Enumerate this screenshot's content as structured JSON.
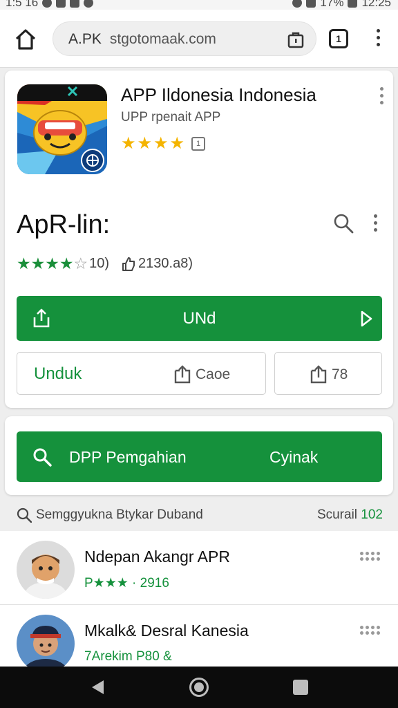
{
  "status_bar": {
    "left_text": "1:5 16",
    "right_text": "17%",
    "time": "12:25"
  },
  "browser": {
    "url_prefix": "A.PK",
    "url_host": "stgotomaak.com",
    "tabs_count": "1"
  },
  "app_card": {
    "title": "APP Ildonesia  Indonesia",
    "subtitle": "UPP rpenait APP",
    "star_rating": 4,
    "mini_icon_text": "1"
  },
  "app_section": {
    "title": "ApR-lin:",
    "star_rating": 4,
    "rating_count": "10)",
    "downloads": "2130.a8)"
  },
  "buttons": {
    "primary_label": "UNd",
    "unduh_label": "Unduk",
    "cache_label": "Caoe",
    "size_label": "78"
  },
  "search_card": {
    "left_label": "DPP Pemgahian",
    "right_label": "Cyinak"
  },
  "filter_row": {
    "text": "Semggyukna Btykar Duband",
    "right_label": "Scurail",
    "right_count": "102"
  },
  "list_items": [
    {
      "title": "Ndepan Akangr APR",
      "subtitle": "P★★★ · 2916"
    },
    {
      "title": "Mkalk& Desral Kanesia",
      "subtitle": "7Arekim P80 &"
    }
  ],
  "colors": {
    "accent_green": "#15913c",
    "star_yellow": "#f4b400"
  }
}
